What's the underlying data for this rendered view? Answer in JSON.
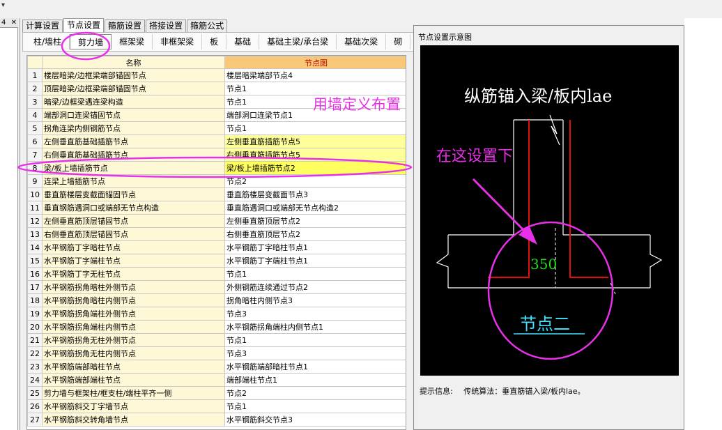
{
  "left_pane": {
    "arrow_glyph": "▾",
    "num_label": "4",
    "close_label": "✕"
  },
  "main_tabs": [
    {
      "label": "计算设置",
      "active": false
    },
    {
      "label": "节点设置",
      "active": true
    },
    {
      "label": "箍筋设置",
      "active": false
    },
    {
      "label": "搭接设置",
      "active": false
    },
    {
      "label": "箍筋公式",
      "active": false
    }
  ],
  "sub_tabs": [
    {
      "label": "柱/墙柱",
      "active": false
    },
    {
      "label": "剪力墙",
      "active": true
    },
    {
      "label": "框架梁",
      "active": false
    },
    {
      "label": "非框架梁",
      "active": false
    },
    {
      "label": "板",
      "active": false
    },
    {
      "label": "基础",
      "active": false
    },
    {
      "label": "基础主梁/承台梁",
      "active": false
    },
    {
      "label": "基础次梁",
      "active": false
    },
    {
      "label": "砌",
      "active": false
    }
  ],
  "grid": {
    "headers": {
      "name": "名称",
      "node": "节点图"
    },
    "rows": [
      {
        "idx": "1",
        "name": "楼层暗梁/边框梁端部锚固节点",
        "node": "楼层暗梁端部节点4"
      },
      {
        "idx": "2",
        "name": "顶层暗梁/边框梁端部锚固节点",
        "node": "节点1"
      },
      {
        "idx": "3",
        "name": "暗梁/边框梁遇连梁构造",
        "node": "节点1"
      },
      {
        "idx": "4",
        "name": "端部洞口连梁锚固节点",
        "node": "端部洞口连梁节点1"
      },
      {
        "idx": "5",
        "name": "拐角连梁内侧钢筋节点",
        "node": "节点1"
      },
      {
        "idx": "6",
        "name": "左侧垂直筋基础插筋节点",
        "node": "左侧垂直筋插筋节点5"
      },
      {
        "idx": "7",
        "name": "右侧垂直筋基础插筋节点",
        "node": "右侧垂直筋插筋节点5"
      },
      {
        "idx": "8",
        "name": "梁/板上墙插筋节点",
        "node": "梁/板上墙插筋节点2"
      },
      {
        "idx": "9",
        "name": "连梁上墙插筋节点",
        "node": "节点2"
      },
      {
        "idx": "10",
        "name": "垂直筋楼层变截面锚固节点",
        "node": "垂直筋楼层变截面节点3"
      },
      {
        "idx": "11",
        "name": "垂直钢筋遇洞口或端部无节点构造",
        "node": "垂直筋遇洞口或端部无节点构造2"
      },
      {
        "idx": "12",
        "name": "左侧垂直筋顶层锚固节点",
        "node": "左侧垂直筋顶层节点2"
      },
      {
        "idx": "13",
        "name": "右侧垂直筋顶层锚固节点",
        "node": "右侧垂直筋顶层节点2"
      },
      {
        "idx": "14",
        "name": "水平钢筋丁字暗柱节点",
        "node": "水平钢筋丁字暗柱节点1"
      },
      {
        "idx": "15",
        "name": "水平钢筋丁字端柱节点",
        "node": "水平钢筋丁字端柱节点1"
      },
      {
        "idx": "16",
        "name": "水平钢筋丁字无柱节点",
        "node": "节点1"
      },
      {
        "idx": "17",
        "name": "水平钢筋拐角暗柱外侧节点",
        "node": "外侧钢筋连续通过节点2"
      },
      {
        "idx": "18",
        "name": "水平钢筋拐角暗柱内侧节点",
        "node": "拐角暗柱内侧节点3"
      },
      {
        "idx": "19",
        "name": "水平钢筋拐角端柱外侧节点",
        "node": "节点3"
      },
      {
        "idx": "20",
        "name": "水平钢筋拐角端柱内侧节点",
        "node": "水平钢筋拐角端柱内侧节点1"
      },
      {
        "idx": "21",
        "name": "水平钢筋拐角无柱外侧节点",
        "node": "节点1"
      },
      {
        "idx": "22",
        "name": "水平钢筋拐角无柱内侧节点",
        "node": "节点3"
      },
      {
        "idx": "23",
        "name": "水平钢筋端部暗柱节点",
        "node": "水平钢筋端部暗柱节点1"
      },
      {
        "idx": "24",
        "name": "水平钢筋端部端柱节点",
        "node": "端部端柱节点1"
      },
      {
        "idx": "25",
        "name": "剪力墙与框架柱/框支柱/端柱平齐一侧",
        "node": "节点2"
      },
      {
        "idx": "26",
        "name": "水平钢筋斜交丁字墙节点",
        "node": "节点1"
      },
      {
        "idx": "27",
        "name": "水平钢筋斜交转角墙节点",
        "node": "水平钢筋斜交节点3"
      }
    ]
  },
  "diagram": {
    "window_title": "节点设置示意图",
    "heading": "纵筋锚入梁/板内lae",
    "dimension": "350",
    "node_label": "节点二",
    "colors": {
      "rebar": "#e01010",
      "outline": "#ffffff",
      "dimension": "#22dd22",
      "label": "#40e0ff",
      "annotation": "#e830e8"
    }
  },
  "hint": {
    "label": "提示信息:",
    "text": "传统算法：垂直筋锚入梁/板内lae。"
  },
  "annotations": {
    "wall_define": "用墙定义布置",
    "set_here": "在这设置下"
  }
}
